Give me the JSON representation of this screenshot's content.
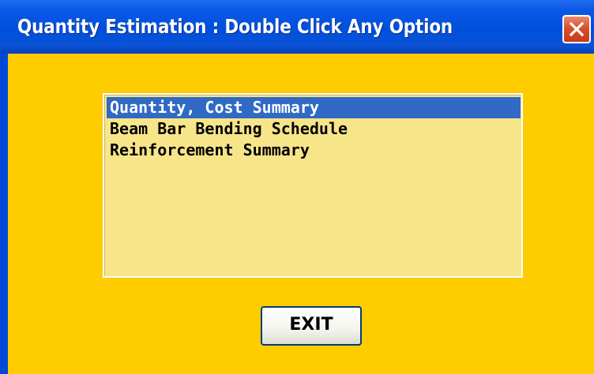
{
  "window": {
    "title": "Quantity Estimation  :  Double Click Any Option",
    "close_icon": "close-icon"
  },
  "listbox": {
    "items": [
      {
        "label": "Quantity, Cost Summary",
        "selected": true
      },
      {
        "label": "Beam Bar Bending Schedule",
        "selected": false
      },
      {
        "label": "Reinforcement Summary",
        "selected": false
      }
    ]
  },
  "exit_button": {
    "label": "EXIT"
  },
  "colors": {
    "titlebar": "#0050dd",
    "client_background": "#ffcc00",
    "listbox_background": "#f7e58a",
    "selection": "#316ac5",
    "close_button": "#d9502e"
  }
}
